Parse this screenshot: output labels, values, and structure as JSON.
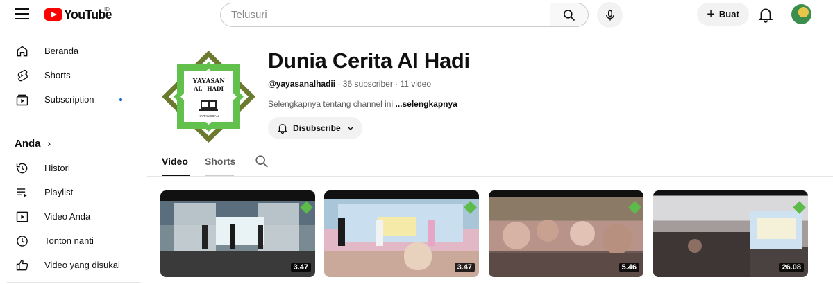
{
  "header": {
    "logo_text": "YouTube",
    "region": "ID",
    "search_placeholder": "Telusuri",
    "create_label": "Buat"
  },
  "sidebar": {
    "main": [
      {
        "label": "Beranda",
        "icon": "home-icon"
      },
      {
        "label": "Shorts",
        "icon": "shorts-icon"
      },
      {
        "label": "Subscription",
        "icon": "subscriptions-icon"
      }
    ],
    "section_title": "Anda",
    "you_items": [
      {
        "label": "Histori",
        "icon": "history-icon"
      },
      {
        "label": "Playlist",
        "icon": "playlist-icon"
      },
      {
        "label": "Video Anda",
        "icon": "your-videos-icon"
      },
      {
        "label": "Tonton nanti",
        "icon": "watch-later-icon"
      },
      {
        "label": "Video yang disukai",
        "icon": "liked-icon"
      }
    ]
  },
  "channel": {
    "name": "Dunia Cerita Al Hadi",
    "handle": "@yayasanalhadii",
    "subscribers": "36 subscriber",
    "videos": "11 video",
    "separator": "·",
    "description": "Selengkapnya tentang channel ini",
    "more_label": "...selengkapnya",
    "subscribe_label": "Disubscribe",
    "logo": {
      "line1": "YAYASAN",
      "line2": "AL - HADI",
      "line3": "KARANGGAN",
      "colors": {
        "outer": "#6b7a2e",
        "inner": "#62c04d"
      }
    }
  },
  "tabs": [
    {
      "label": "Video",
      "active": true
    },
    {
      "label": "Shorts",
      "active": false
    }
  ],
  "videos": [
    {
      "duration": "3.47"
    },
    {
      "duration": "3.47"
    },
    {
      "duration": "5.46"
    },
    {
      "duration": "26.08"
    }
  ]
}
